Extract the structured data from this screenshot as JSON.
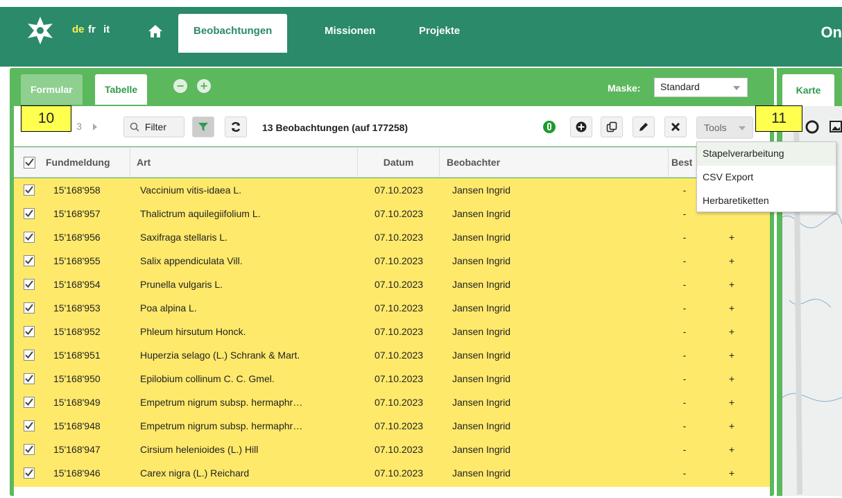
{
  "nav": {
    "lang_de": "de",
    "lang_fr": "fr",
    "lang_it": "it",
    "items": [
      "Beobachtungen",
      "Missionen",
      "Projekte"
    ],
    "brand_right": "On"
  },
  "tabs": {
    "formular": "Formular",
    "tabelle": "Tabelle"
  },
  "maske": {
    "label": "Maske:",
    "value": "Standard"
  },
  "karte_tab": "Karte",
  "toolbar": {
    "filter_label": "Filter",
    "count_label": "13 Beobachtungen (auf 177258)",
    "tools_label": "Tools",
    "pager_partial": "3"
  },
  "annotations": {
    "left": "10",
    "right": "11"
  },
  "tools_menu": [
    "Stapelverarbeitung",
    "CSV Export",
    "Herbaretiketten"
  ],
  "table": {
    "headers": [
      "Fundmeldung",
      "Art",
      "Datum",
      "Beobachter",
      "Best"
    ],
    "rows": [
      [
        "15'168'958",
        "Vaccinium vitis-idaea L.",
        "07.10.2023",
        "Jansen Ingrid",
        "-",
        ""
      ],
      [
        "15'168'957",
        "Thalictrum aquilegiifolium L.",
        "07.10.2023",
        "Jansen Ingrid",
        "-",
        ""
      ],
      [
        "15'168'956",
        "Saxifraga stellaris L.",
        "07.10.2023",
        "Jansen Ingrid",
        "-",
        "+"
      ],
      [
        "15'168'955",
        "Salix appendiculata Vill.",
        "07.10.2023",
        "Jansen Ingrid",
        "-",
        "+"
      ],
      [
        "15'168'954",
        "Prunella vulgaris L.",
        "07.10.2023",
        "Jansen Ingrid",
        "-",
        "+"
      ],
      [
        "15'168'953",
        "Poa alpina L.",
        "07.10.2023",
        "Jansen Ingrid",
        "-",
        "+"
      ],
      [
        "15'168'952",
        "Phleum hirsutum Honck.",
        "07.10.2023",
        "Jansen Ingrid",
        "-",
        "+"
      ],
      [
        "15'168'951",
        "Huperzia selago (L.) Schrank & Mart.",
        "07.10.2023",
        "Jansen Ingrid",
        "-",
        "+"
      ],
      [
        "15'168'950",
        "Epilobium collinum C. C. Gmel.",
        "07.10.2023",
        "Jansen Ingrid",
        "-",
        "+"
      ],
      [
        "15'168'949",
        "Empetrum nigrum subsp. hermaphr…",
        "07.10.2023",
        "Jansen Ingrid",
        "-",
        "+"
      ],
      [
        "15'168'948",
        "Empetrum nigrum subsp. hermaphr…",
        "07.10.2023",
        "Jansen Ingrid",
        "-",
        "+"
      ],
      [
        "15'168'947",
        "Cirsium helenioides (L.) Hill",
        "07.10.2023",
        "Jansen Ingrid",
        "-",
        "+"
      ],
      [
        "15'168'946",
        "Carex nigra (L.) Reichard",
        "07.10.2023",
        "Jansen Ingrid",
        "-",
        "+"
      ]
    ]
  },
  "colors": {
    "header_green": "#2a8a6a",
    "panel_green": "#5cb85c",
    "row_yellow": "#ffe96b",
    "annotation_yellow": "#ffff4f"
  }
}
